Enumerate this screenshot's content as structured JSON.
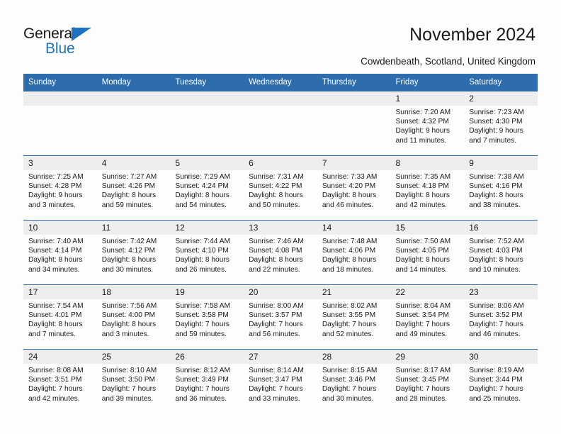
{
  "brand": {
    "name_part1": "General",
    "name_part2": "Blue",
    "accent_color": "#1f72bd"
  },
  "header": {
    "title": "November 2024",
    "subtitle": "Cowdenbeath, Scotland, United Kingdom"
  },
  "theme": {
    "header_blue": "#2e6dad",
    "daynum_band": "#eeeeee",
    "page_background": "#fdfdfd"
  },
  "calendar": {
    "weekday_headers": [
      "Sunday",
      "Monday",
      "Tuesday",
      "Wednesday",
      "Thursday",
      "Friday",
      "Saturday"
    ],
    "weeks": [
      [
        {
          "day": "",
          "lines": []
        },
        {
          "day": "",
          "lines": []
        },
        {
          "day": "",
          "lines": []
        },
        {
          "day": "",
          "lines": []
        },
        {
          "day": "",
          "lines": []
        },
        {
          "day": "1",
          "lines": [
            "Sunrise: 7:20 AM",
            "Sunset: 4:32 PM",
            "Daylight: 9 hours",
            "and 11 minutes."
          ]
        },
        {
          "day": "2",
          "lines": [
            "Sunrise: 7:23 AM",
            "Sunset: 4:30 PM",
            "Daylight: 9 hours",
            "and 7 minutes."
          ]
        }
      ],
      [
        {
          "day": "3",
          "lines": [
            "Sunrise: 7:25 AM",
            "Sunset: 4:28 PM",
            "Daylight: 9 hours",
            "and 3 minutes."
          ]
        },
        {
          "day": "4",
          "lines": [
            "Sunrise: 7:27 AM",
            "Sunset: 4:26 PM",
            "Daylight: 8 hours",
            "and 59 minutes."
          ]
        },
        {
          "day": "5",
          "lines": [
            "Sunrise: 7:29 AM",
            "Sunset: 4:24 PM",
            "Daylight: 8 hours",
            "and 54 minutes."
          ]
        },
        {
          "day": "6",
          "lines": [
            "Sunrise: 7:31 AM",
            "Sunset: 4:22 PM",
            "Daylight: 8 hours",
            "and 50 minutes."
          ]
        },
        {
          "day": "7",
          "lines": [
            "Sunrise: 7:33 AM",
            "Sunset: 4:20 PM",
            "Daylight: 8 hours",
            "and 46 minutes."
          ]
        },
        {
          "day": "8",
          "lines": [
            "Sunrise: 7:35 AM",
            "Sunset: 4:18 PM",
            "Daylight: 8 hours",
            "and 42 minutes."
          ]
        },
        {
          "day": "9",
          "lines": [
            "Sunrise: 7:38 AM",
            "Sunset: 4:16 PM",
            "Daylight: 8 hours",
            "and 38 minutes."
          ]
        }
      ],
      [
        {
          "day": "10",
          "lines": [
            "Sunrise: 7:40 AM",
            "Sunset: 4:14 PM",
            "Daylight: 8 hours",
            "and 34 minutes."
          ]
        },
        {
          "day": "11",
          "lines": [
            "Sunrise: 7:42 AM",
            "Sunset: 4:12 PM",
            "Daylight: 8 hours",
            "and 30 minutes."
          ]
        },
        {
          "day": "12",
          "lines": [
            "Sunrise: 7:44 AM",
            "Sunset: 4:10 PM",
            "Daylight: 8 hours",
            "and 26 minutes."
          ]
        },
        {
          "day": "13",
          "lines": [
            "Sunrise: 7:46 AM",
            "Sunset: 4:08 PM",
            "Daylight: 8 hours",
            "and 22 minutes."
          ]
        },
        {
          "day": "14",
          "lines": [
            "Sunrise: 7:48 AM",
            "Sunset: 4:06 PM",
            "Daylight: 8 hours",
            "and 18 minutes."
          ]
        },
        {
          "day": "15",
          "lines": [
            "Sunrise: 7:50 AM",
            "Sunset: 4:05 PM",
            "Daylight: 8 hours",
            "and 14 minutes."
          ]
        },
        {
          "day": "16",
          "lines": [
            "Sunrise: 7:52 AM",
            "Sunset: 4:03 PM",
            "Daylight: 8 hours",
            "and 10 minutes."
          ]
        }
      ],
      [
        {
          "day": "17",
          "lines": [
            "Sunrise: 7:54 AM",
            "Sunset: 4:01 PM",
            "Daylight: 8 hours",
            "and 7 minutes."
          ]
        },
        {
          "day": "18",
          "lines": [
            "Sunrise: 7:56 AM",
            "Sunset: 4:00 PM",
            "Daylight: 8 hours",
            "and 3 minutes."
          ]
        },
        {
          "day": "19",
          "lines": [
            "Sunrise: 7:58 AM",
            "Sunset: 3:58 PM",
            "Daylight: 7 hours",
            "and 59 minutes."
          ]
        },
        {
          "day": "20",
          "lines": [
            "Sunrise: 8:00 AM",
            "Sunset: 3:57 PM",
            "Daylight: 7 hours",
            "and 56 minutes."
          ]
        },
        {
          "day": "21",
          "lines": [
            "Sunrise: 8:02 AM",
            "Sunset: 3:55 PM",
            "Daylight: 7 hours",
            "and 52 minutes."
          ]
        },
        {
          "day": "22",
          "lines": [
            "Sunrise: 8:04 AM",
            "Sunset: 3:54 PM",
            "Daylight: 7 hours",
            "and 49 minutes."
          ]
        },
        {
          "day": "23",
          "lines": [
            "Sunrise: 8:06 AM",
            "Sunset: 3:52 PM",
            "Daylight: 7 hours",
            "and 46 minutes."
          ]
        }
      ],
      [
        {
          "day": "24",
          "lines": [
            "Sunrise: 8:08 AM",
            "Sunset: 3:51 PM",
            "Daylight: 7 hours",
            "and 42 minutes."
          ]
        },
        {
          "day": "25",
          "lines": [
            "Sunrise: 8:10 AM",
            "Sunset: 3:50 PM",
            "Daylight: 7 hours",
            "and 39 minutes."
          ]
        },
        {
          "day": "26",
          "lines": [
            "Sunrise: 8:12 AM",
            "Sunset: 3:49 PM",
            "Daylight: 7 hours",
            "and 36 minutes."
          ]
        },
        {
          "day": "27",
          "lines": [
            "Sunrise: 8:14 AM",
            "Sunset: 3:47 PM",
            "Daylight: 7 hours",
            "and 33 minutes."
          ]
        },
        {
          "day": "28",
          "lines": [
            "Sunrise: 8:15 AM",
            "Sunset: 3:46 PM",
            "Daylight: 7 hours",
            "and 30 minutes."
          ]
        },
        {
          "day": "29",
          "lines": [
            "Sunrise: 8:17 AM",
            "Sunset: 3:45 PM",
            "Daylight: 7 hours",
            "and 28 minutes."
          ]
        },
        {
          "day": "30",
          "lines": [
            "Sunrise: 8:19 AM",
            "Sunset: 3:44 PM",
            "Daylight: 7 hours",
            "and 25 minutes."
          ]
        }
      ]
    ]
  }
}
